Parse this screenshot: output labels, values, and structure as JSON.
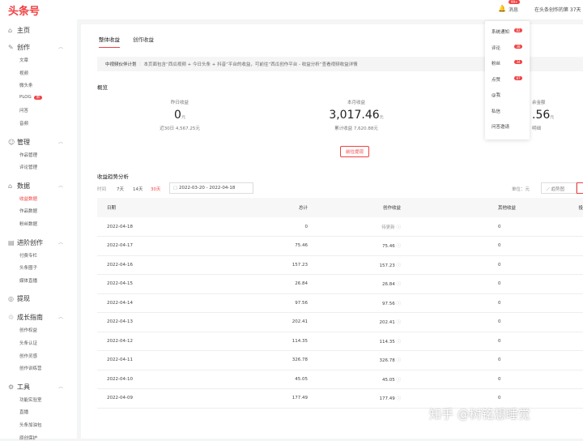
{
  "header": {
    "logo": "头条号",
    "messages": "消息",
    "msg_badge": "99+",
    "days": "在头条创作的第 37天"
  },
  "sidebar": {
    "home": "主页",
    "groups": [
      {
        "label": "创作",
        "items": [
          "文章",
          "视频",
          "微头条",
          "PLOG",
          "问答",
          "音频"
        ],
        "badge": "新"
      },
      {
        "label": "管理",
        "items": [
          "作品管理",
          "评论管理"
        ]
      },
      {
        "label": "数据",
        "items": [
          "收益数据",
          "作品数据",
          "粉丝数据"
        ]
      },
      {
        "label": "进阶创作",
        "items": [
          "付费专栏",
          "头条圈子",
          "媒体直播"
        ]
      },
      {
        "label": "提现",
        "items": []
      },
      {
        "label": "成长指南",
        "items": [
          "创作权益",
          "头条认证",
          "创作灵感",
          "创作训练营"
        ]
      },
      {
        "label": "工具",
        "items": [
          "功能实验室",
          "直播",
          "头条加油包",
          "原创保护"
        ]
      }
    ]
  },
  "tabs": [
    "整体收益",
    "创作收益"
  ],
  "notice": {
    "title": "中视频伙伴计划",
    "text": "本页面包含“西瓜视频 + 今日头条 + 抖音”平台的收益，可前往“西瓜创作平台 - 收益分析”查看视频收益详情"
  },
  "overview": {
    "title": "概览",
    "yesterday": {
      "label": "昨日收益",
      "value": "0",
      "unit": "元",
      "sub": "近30日 4,567.25元"
    },
    "month": {
      "label": "本月收益",
      "value": "3,017.46",
      "unit": "元",
      "sub": "累计收益 7,620.88元"
    },
    "balance": {
      "label": "余金额",
      "value": ".56",
      "unit": "元",
      "sub": "明细"
    },
    "withdraw": "前往提现"
  },
  "trend": {
    "title": "收益趋势分析",
    "time_label": "时间",
    "ranges": [
      "7天",
      "14天",
      "30天"
    ],
    "start": "2022-03-20",
    "end": "2022-04-18",
    "unit": "单位：元",
    "chart_btn": "趋势图"
  },
  "table": {
    "headers": [
      "日期",
      "总计",
      "创作收益",
      "其他收益",
      "投"
    ],
    "rows": [
      [
        "2022-04-18",
        "0",
        "待更新",
        "0"
      ],
      [
        "2022-04-17",
        "75.46",
        "75.46",
        "0"
      ],
      [
        "2022-04-16",
        "157.23",
        "157.23",
        "0"
      ],
      [
        "2022-04-15",
        "26.84",
        "26.84",
        "0"
      ],
      [
        "2022-04-14",
        "97.56",
        "97.56",
        "0"
      ],
      [
        "2022-04-13",
        "202.41",
        "202.41",
        "0"
      ],
      [
        "2022-04-12",
        "114.35",
        "114.35",
        "0"
      ],
      [
        "2022-04-11",
        "326.78",
        "326.78",
        "0"
      ],
      [
        "2022-04-10",
        "45.05",
        "45.05",
        "0"
      ],
      [
        "2022-04-09",
        "177.49",
        "177.49",
        "0"
      ]
    ]
  },
  "dropdown": [
    {
      "label": "系统通知",
      "badge": "82"
    },
    {
      "label": "评论",
      "badge": "38"
    },
    {
      "label": "粉丝",
      "badge": "34"
    },
    {
      "label": "点赞",
      "badge": "87"
    },
    {
      "label": "@我"
    },
    {
      "label": "私信"
    },
    {
      "label": "问答邀请"
    }
  ],
  "watermark": "知乎 @树铭想睡觉"
}
